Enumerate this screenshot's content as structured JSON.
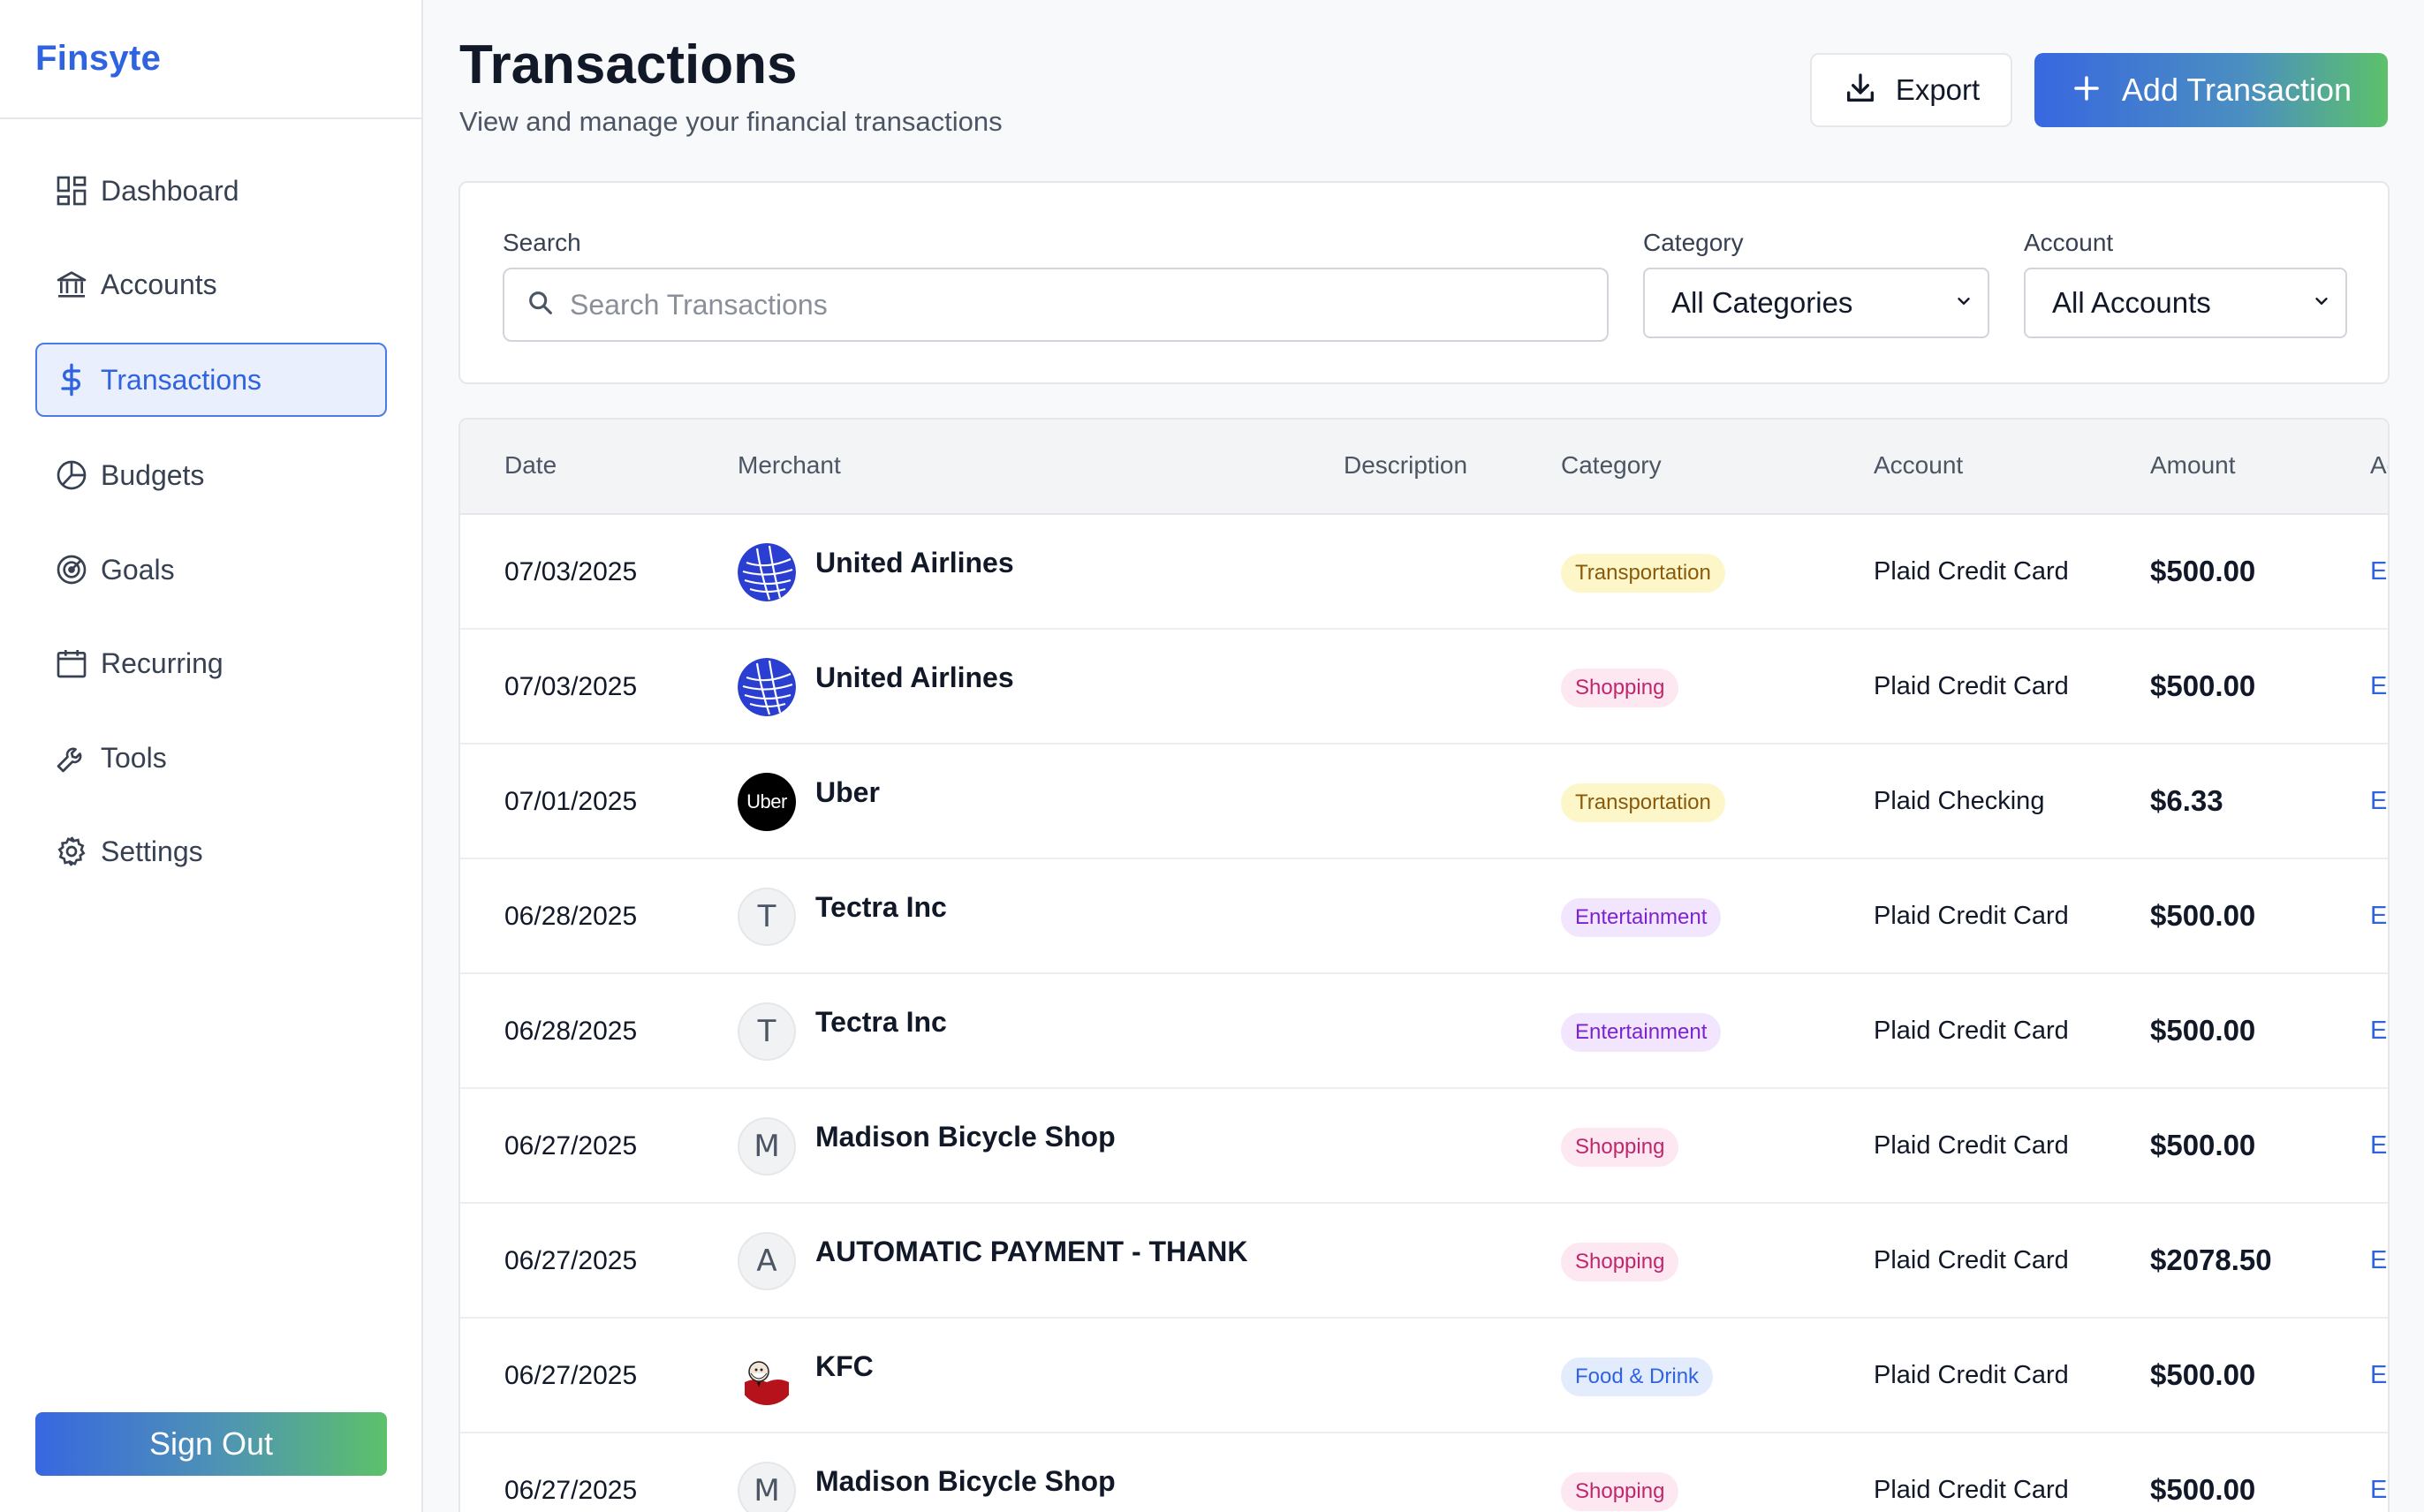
{
  "app": {
    "brand": "Finsyte"
  },
  "sidebar": {
    "items": [
      {
        "label": "Dashboard",
        "icon": "dashboard-icon",
        "active": false
      },
      {
        "label": "Accounts",
        "icon": "bank-icon",
        "active": false
      },
      {
        "label": "Transactions",
        "icon": "dollar-icon",
        "active": true
      },
      {
        "label": "Budgets",
        "icon": "pie-chart-icon",
        "active": false
      },
      {
        "label": "Goals",
        "icon": "target-icon",
        "active": false
      },
      {
        "label": "Recurring",
        "icon": "calendar-icon",
        "active": false
      },
      {
        "label": "Tools",
        "icon": "wrench-icon",
        "active": false
      },
      {
        "label": "Settings",
        "icon": "gear-icon",
        "active": false
      }
    ],
    "sign_out": "Sign Out"
  },
  "header": {
    "title": "Transactions",
    "subtitle": "View and manage your financial transactions",
    "export_label": "Export",
    "add_label": "Add Transaction"
  },
  "filters": {
    "search_label": "Search",
    "search_placeholder": "Search Transactions",
    "search_value": "",
    "category_label": "Category",
    "category_value": "All Categories",
    "account_label": "Account",
    "account_value": "All Accounts"
  },
  "table": {
    "columns": [
      "Date",
      "Merchant",
      "Description",
      "Category",
      "Account",
      "Amount",
      "Ac"
    ],
    "rows": [
      {
        "date": "07/03/2025",
        "merchant": "United Airlines",
        "logo": "united-airlines",
        "initial": "",
        "description": "",
        "category": "Transportation",
        "account": "Plaid Credit Card",
        "amount": "$500.00",
        "action": "Ed"
      },
      {
        "date": "07/03/2025",
        "merchant": "United Airlines",
        "logo": "united-airlines",
        "initial": "",
        "description": "",
        "category": "Shopping",
        "account": "Plaid Credit Card",
        "amount": "$500.00",
        "action": "Ed"
      },
      {
        "date": "07/01/2025",
        "merchant": "Uber",
        "logo": "uber",
        "initial": "Uber",
        "description": "",
        "category": "Transportation",
        "account": "Plaid Checking",
        "amount": "$6.33",
        "action": "Ed"
      },
      {
        "date": "06/28/2025",
        "merchant": "Tectra Inc",
        "logo": "letter",
        "initial": "T",
        "description": "",
        "category": "Entertainment",
        "account": "Plaid Credit Card",
        "amount": "$500.00",
        "action": "Ed"
      },
      {
        "date": "06/28/2025",
        "merchant": "Tectra Inc",
        "logo": "letter",
        "initial": "T",
        "description": "",
        "category": "Entertainment",
        "account": "Plaid Credit Card",
        "amount": "$500.00",
        "action": "Ed"
      },
      {
        "date": "06/27/2025",
        "merchant": "Madison Bicycle Shop",
        "logo": "letter",
        "initial": "M",
        "description": "",
        "category": "Shopping",
        "account": "Plaid Credit Card",
        "amount": "$500.00",
        "action": "Ed"
      },
      {
        "date": "06/27/2025",
        "merchant": "AUTOMATIC PAYMENT - THANK",
        "logo": "letter",
        "initial": "A",
        "description": "",
        "category": "Shopping",
        "account": "Plaid Credit Card",
        "amount": "$2078.50",
        "action": "Ed"
      },
      {
        "date": "06/27/2025",
        "merchant": "KFC",
        "logo": "kfc",
        "initial": "KFC",
        "description": "",
        "category": "Food & Drink",
        "account": "Plaid Credit Card",
        "amount": "$500.00",
        "action": "Ed"
      },
      {
        "date": "06/27/2025",
        "merchant": "Madison Bicycle Shop",
        "logo": "letter",
        "initial": "M",
        "description": "",
        "category": "Shopping",
        "account": "Plaid Credit Card",
        "amount": "$500.00",
        "action": "Ed"
      }
    ]
  },
  "category_colors": {
    "Transportation": {
      "bg": "#fdf6c8",
      "fg": "#8a5a0b"
    },
    "Shopping": {
      "bg": "#fde7f1",
      "fg": "#c0266d"
    },
    "Entertainment": {
      "bg": "#f1e6fd",
      "fg": "#7e22ce"
    },
    "Food & Drink": {
      "bg": "#e3ecfd",
      "fg": "#2f63e0"
    }
  },
  "colors": {
    "accent": "#2f63e0",
    "gradient_start": "#3867e0",
    "gradient_end": "#5cc16a"
  }
}
